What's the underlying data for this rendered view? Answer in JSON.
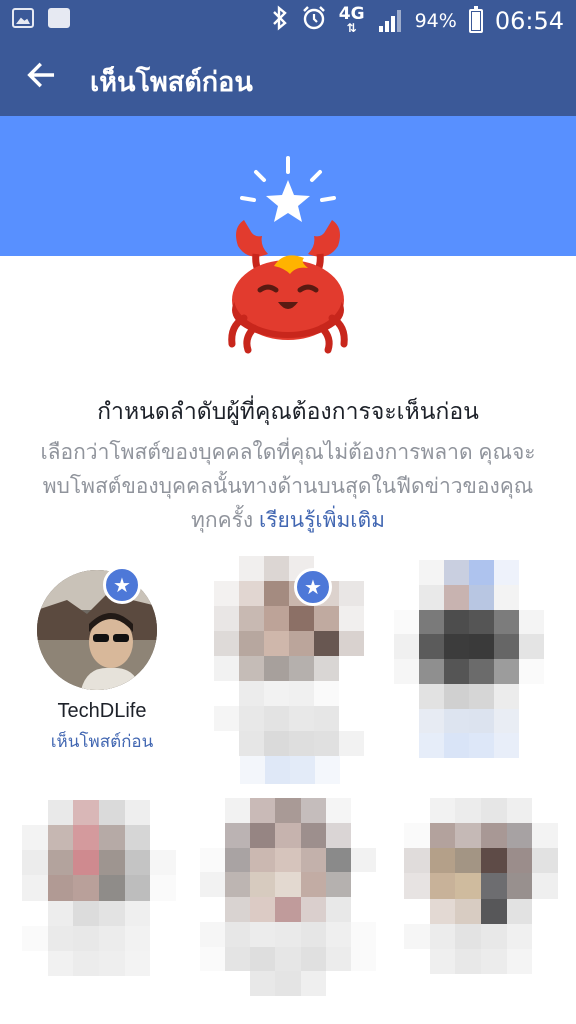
{
  "status_bar": {
    "network": "4G",
    "battery_pct": "94%",
    "time": "06:54"
  },
  "app_bar": {
    "title": "เห็นโพสต์ก่อน"
  },
  "intro": {
    "headline": "กำหนดลำดับผู้ที่คุณต้องการจะเห็นก่อน",
    "description": "เลือกว่าโพสต์ของบุคคลใดที่คุณไม่ต้องการพลาด คุณจะพบโพสต์ของบุคคลนั้นทางด้านบนสุดในฟีดข่าวของคุณทุกครั้ง",
    "learn_more": "เรียนรู้เพิ่มเติม"
  },
  "people": [
    {
      "name": "TechDLife",
      "status": "เห็นโพสต์ก่อน",
      "starred": true
    },
    {
      "name": "",
      "status": "",
      "starred": true
    },
    {
      "name": "",
      "status": "",
      "starred": false
    },
    {
      "name": "",
      "status": "",
      "starred": false
    },
    {
      "name": "",
      "status": "",
      "starred": false
    },
    {
      "name": "",
      "status": "",
      "starred": false
    }
  ]
}
